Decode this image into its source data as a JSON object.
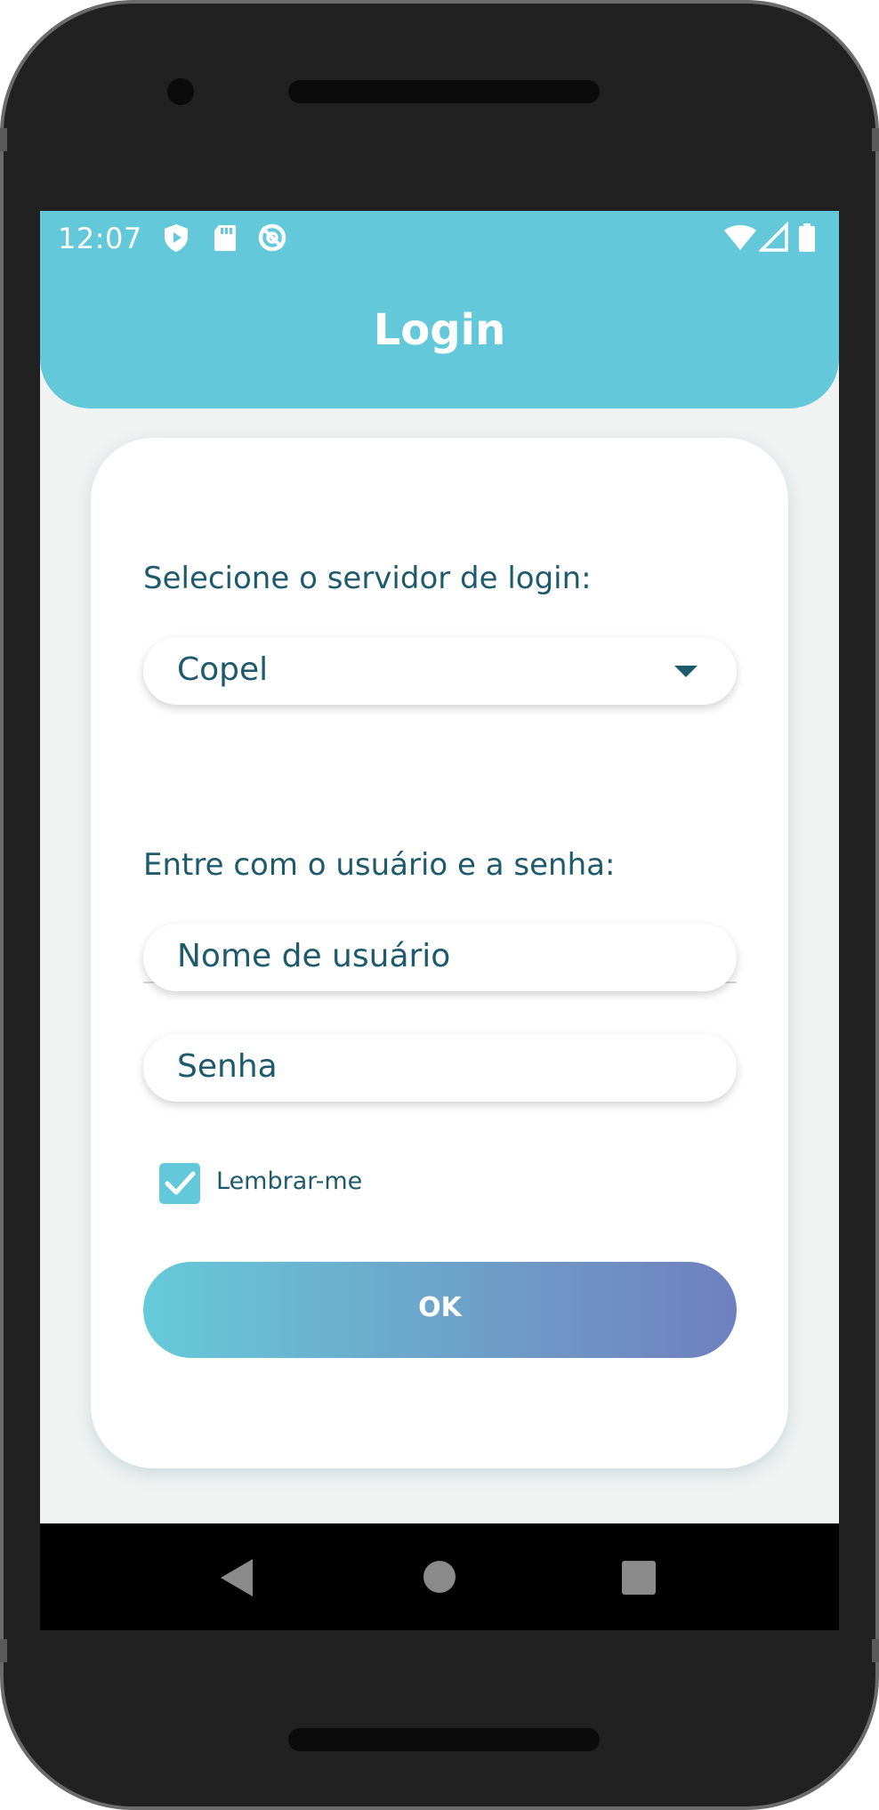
{
  "status_bar": {
    "time": "12:07",
    "left_icons": [
      "shield-play-icon",
      "sd-card-icon",
      "data-saver-icon"
    ],
    "right_icons": [
      "wifi-icon",
      "signal-icon",
      "battery-icon"
    ]
  },
  "appbar": {
    "title": "Login"
  },
  "login_form": {
    "server_label": "Selecione o servidor de login:",
    "server_selected": "Copel",
    "credentials_label": "Entre com o usuário e a senha:",
    "username_placeholder": "Nome de usuário",
    "password_placeholder": "Senha",
    "remember_label": "Lembrar-me",
    "remember_checked": true,
    "submit_label": "OK"
  },
  "nav_bar": {
    "icons": [
      "back-icon",
      "home-icon",
      "recents-icon"
    ]
  },
  "colors": {
    "primary": "#63c9da",
    "text": "#1d5a6c",
    "button_gradient_start": "#66cad9",
    "button_gradient_end": "#6f80c0",
    "background": "#f1f2f2"
  }
}
